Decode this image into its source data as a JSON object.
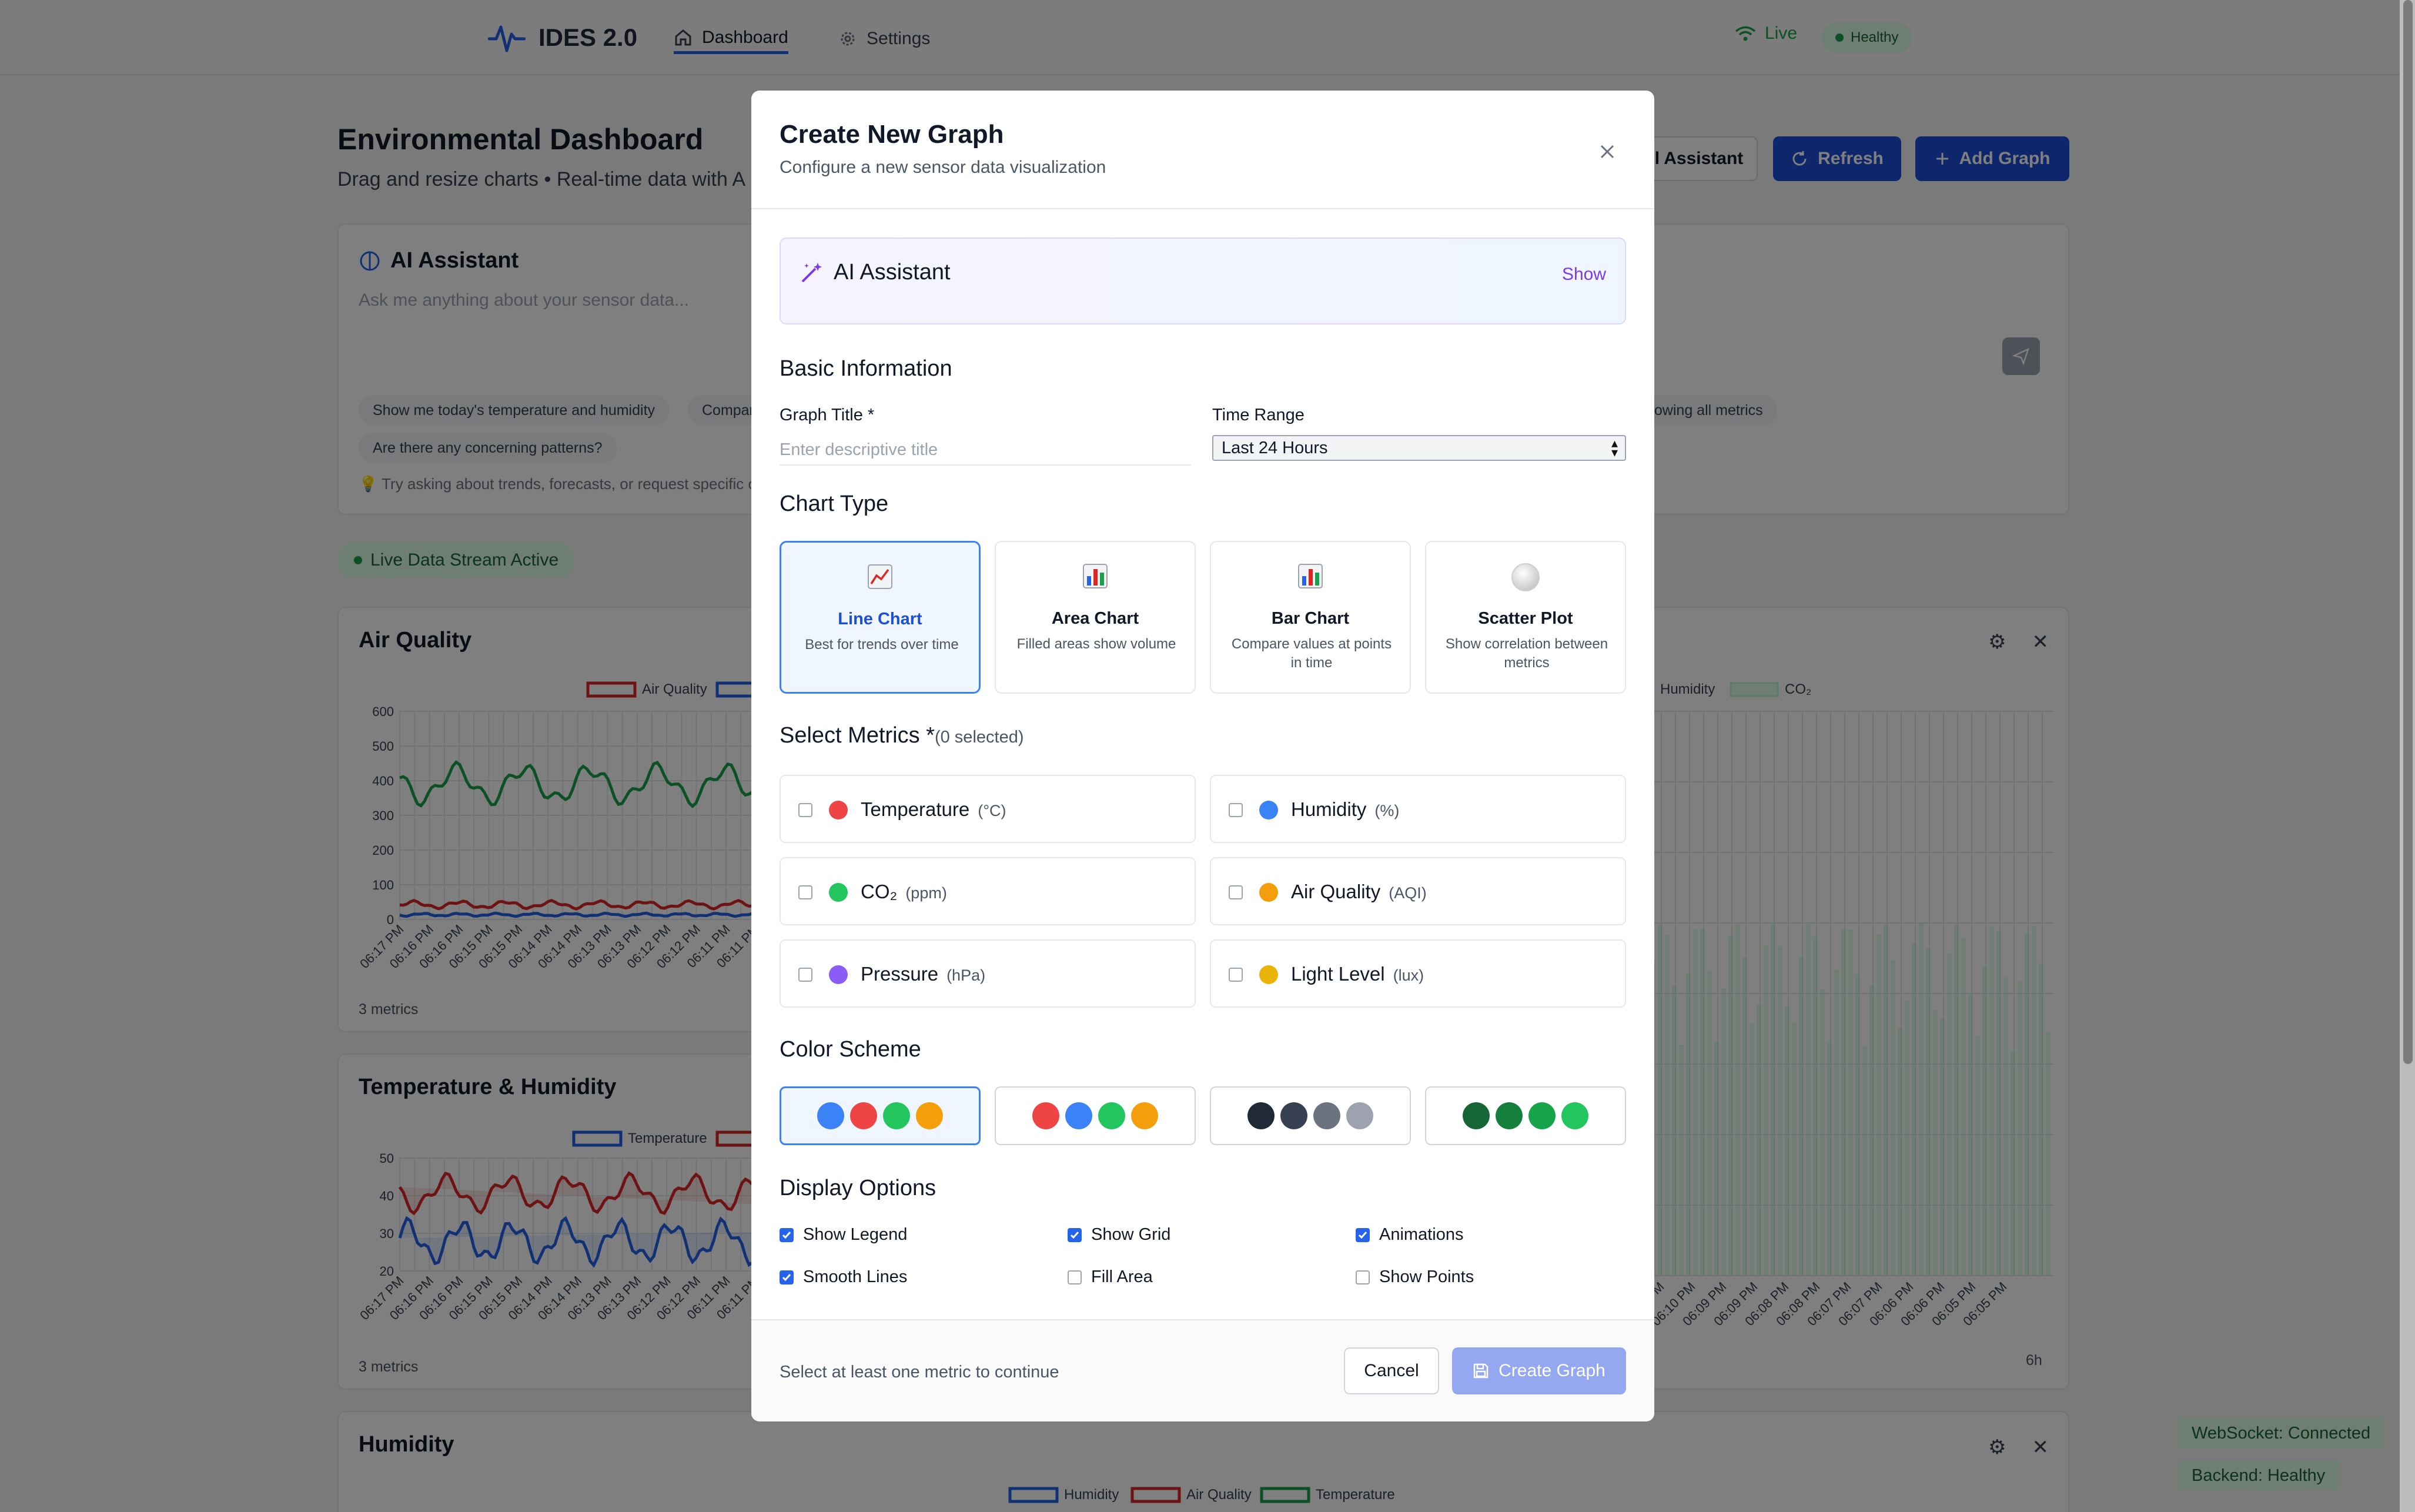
{
  "nav": {
    "brand": "IDES 2.0",
    "tabs": [
      {
        "label": "Dashboard",
        "active": true
      },
      {
        "label": "Settings",
        "active": false
      }
    ],
    "live_label": "Live",
    "health_label": "Healthy"
  },
  "dashboard": {
    "title": "Environmental Dashboard",
    "subtitle": "Drag and resize charts • Real-time data with A",
    "buttons": {
      "ai_assistant": "l Assistant",
      "refresh": "Refresh",
      "add_graph": "Add Graph"
    },
    "ai_panel": {
      "title": "AI Assistant",
      "placeholder": "Ask me anything about your sensor data...",
      "suggestions": [
        "Show me today's temperature and humidity",
        "Compar",
        "howing all metrics",
        "Are there any concerning patterns?"
      ],
      "tip": "💡 Try asking about trends, forecasts, or request specific c"
    },
    "stream_status": "Live Data Stream Active",
    "charts": [
      {
        "title": "Air Quality",
        "legend": [
          "Air Quality"
        ],
        "metrics": "3 metrics",
        "y_ticks": [
          "600",
          "500",
          "400",
          "300",
          "200",
          "100",
          "0"
        ],
        "x_ticks": [
          "06:17 PM",
          "06:16 PM",
          "06:16 PM",
          "06:15 PM",
          "06:15 PM",
          "06:14 PM",
          "06:14 PM",
          "06:13 PM",
          "06:13 PM",
          "06:12 PM",
          "06:12 PM",
          "06:11 PM",
          "06:11 PM"
        ]
      },
      {
        "title": "Temperature & Humidity",
        "legend": [
          "Temperature"
        ],
        "metrics": "3 metrics",
        "y_ticks": [
          "50",
          "40",
          "30",
          "20"
        ],
        "x_ticks": [
          "06:17 PM",
          "06:16 PM",
          "06:16 PM",
          "06:15 PM",
          "06:15 PM",
          "06:14 PM",
          "06:14 PM",
          "06:13 PM",
          "06:13 PM",
          "06:12 PM",
          "06:12 PM",
          "06:11 PM",
          "06:11 PM"
        ]
      },
      {
        "title": "",
        "legend": [
          "Humidity",
          "CO₂"
        ],
        "range_label": "6h",
        "x_ticks": [
          "06:10 PM",
          "06:10 PM",
          "06:09 PM",
          "06:09 PM",
          "06:08 PM",
          "06:08 PM",
          "06:07 PM",
          "06:07 PM",
          "06:06 PM",
          "06:06 PM",
          "06:05 PM",
          "06:05 PM"
        ]
      },
      {
        "title": "Humidity",
        "legend": [
          "Humidity",
          "Air Quality",
          "Temperature"
        ]
      }
    ],
    "status_badges": [
      "WebSocket: Connected",
      "Backend: Healthy"
    ]
  },
  "modal": {
    "title": "Create New Graph",
    "subtitle": "Configure a new sensor data visualization",
    "ai_assistant": {
      "label": "AI Assistant",
      "toggle": "Show"
    },
    "basic_info": {
      "heading": "Basic Information",
      "title_label": "Graph Title *",
      "title_placeholder": "Enter descriptive title",
      "range_label": "Time Range",
      "range_value": "Last 24 Hours"
    },
    "chart_type": {
      "heading": "Chart Type",
      "options": [
        {
          "name": "Line Chart",
          "desc": "Best for trends over time",
          "icon": "line-chart-icon",
          "selected": true
        },
        {
          "name": "Area Chart",
          "desc": "Filled areas show volume",
          "icon": "bar-chart-icon",
          "selected": false
        },
        {
          "name": "Bar Chart",
          "desc": "Compare values at points in time",
          "icon": "bar-chart-icon",
          "selected": false
        },
        {
          "name": "Scatter Plot",
          "desc": "Show correlation between metrics",
          "icon": "circle-icon",
          "selected": false
        }
      ]
    },
    "metrics": {
      "heading": "Select Metrics *",
      "count": "(0 selected)",
      "items": [
        {
          "name": "Temperature",
          "unit": "(°C)",
          "color": "#ef4444"
        },
        {
          "name": "Humidity",
          "unit": "(%)",
          "color": "#3b82f6"
        },
        {
          "name": "CO₂",
          "unit": "(ppm)",
          "color": "#22c55e"
        },
        {
          "name": "Air Quality",
          "unit": "(AQI)",
          "color": "#f59e0b"
        },
        {
          "name": "Pressure",
          "unit": "(hPa)",
          "color": "#8b5cf6"
        },
        {
          "name": "Light Level",
          "unit": "(lux)",
          "color": "#eab308"
        }
      ]
    },
    "color_scheme": {
      "heading": "Color Scheme",
      "schemes": [
        {
          "colors": [
            "#3b82f6",
            "#ef4444",
            "#22c55e",
            "#f59e0b"
          ],
          "selected": true
        },
        {
          "colors": [
            "#ef4444",
            "#3b82f6",
            "#22c55e",
            "#f59e0b"
          ],
          "selected": false
        },
        {
          "colors": [
            "#1f2937",
            "#374151",
            "#6b7280",
            "#9ca3af"
          ],
          "selected": false
        },
        {
          "colors": [
            "#166534",
            "#15803d",
            "#16a34a",
            "#22c55e"
          ],
          "selected": false
        }
      ]
    },
    "display_options": {
      "heading": "Display Options",
      "options": [
        {
          "label": "Show Legend",
          "checked": true
        },
        {
          "label": "Show Grid",
          "checked": true
        },
        {
          "label": "Animations",
          "checked": true
        },
        {
          "label": "Smooth Lines",
          "checked": true
        },
        {
          "label": "Fill Area",
          "checked": false
        },
        {
          "label": "Show Points",
          "checked": false
        }
      ]
    },
    "footer": {
      "hint": "Select at least one metric to continue",
      "cancel": "Cancel",
      "create": "Create Graph"
    }
  }
}
